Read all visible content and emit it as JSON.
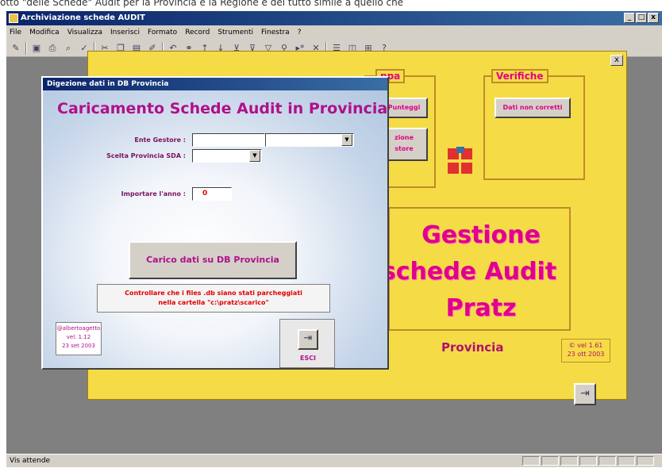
{
  "top_text": "otto \"delle Schede\" Audit per la Provincia e la Regione è del tutto simile a quello che",
  "window": {
    "title": "Archiviazione schede AUDIT",
    "controls": [
      "_",
      "□",
      "x"
    ]
  },
  "menu": [
    "File",
    "Modifica",
    "Visualizza",
    "Inserisci",
    "Formato",
    "Record",
    "Strumenti",
    "Finestra",
    "?"
  ],
  "status": {
    "text": "Vis attende"
  },
  "main_form": {
    "close": "x",
    "mappa_label": "ppa",
    "punteggi_button": "Punteggi",
    "gestore_button": "zione\nstore",
    "verifiche_label": "Verifiche",
    "dati_button": "Dati non corretti",
    "big_line1": "Gestione",
    "big_line2": "schede Audit",
    "big_line3": "Pratz",
    "provincia": "Provincia",
    "version_line1": "© vel 1.61",
    "version_line2": "23 ott 2003"
  },
  "dialog": {
    "title": "Digezione dati in DB Provincia",
    "heading": "Caricamento Schede Audit in Provincia",
    "ente_label": "Ente Gestore :",
    "scelta_label": "Scelta Provincia SDA :",
    "anno_label": "Importare l'anno :",
    "anno_value": "0",
    "load_button": "Carico dati su DB Provincia",
    "warn_line1": "Controllare che i files  .db siano stati parcheggiati",
    "warn_line2": "nella cartella \"c:\\pratz\\scarico\"",
    "sig_line1": "@albertoagetto",
    "sig_line2": "vel. 1.12",
    "sig_line3": "23 set 2003",
    "esci_label": "ESCI"
  }
}
